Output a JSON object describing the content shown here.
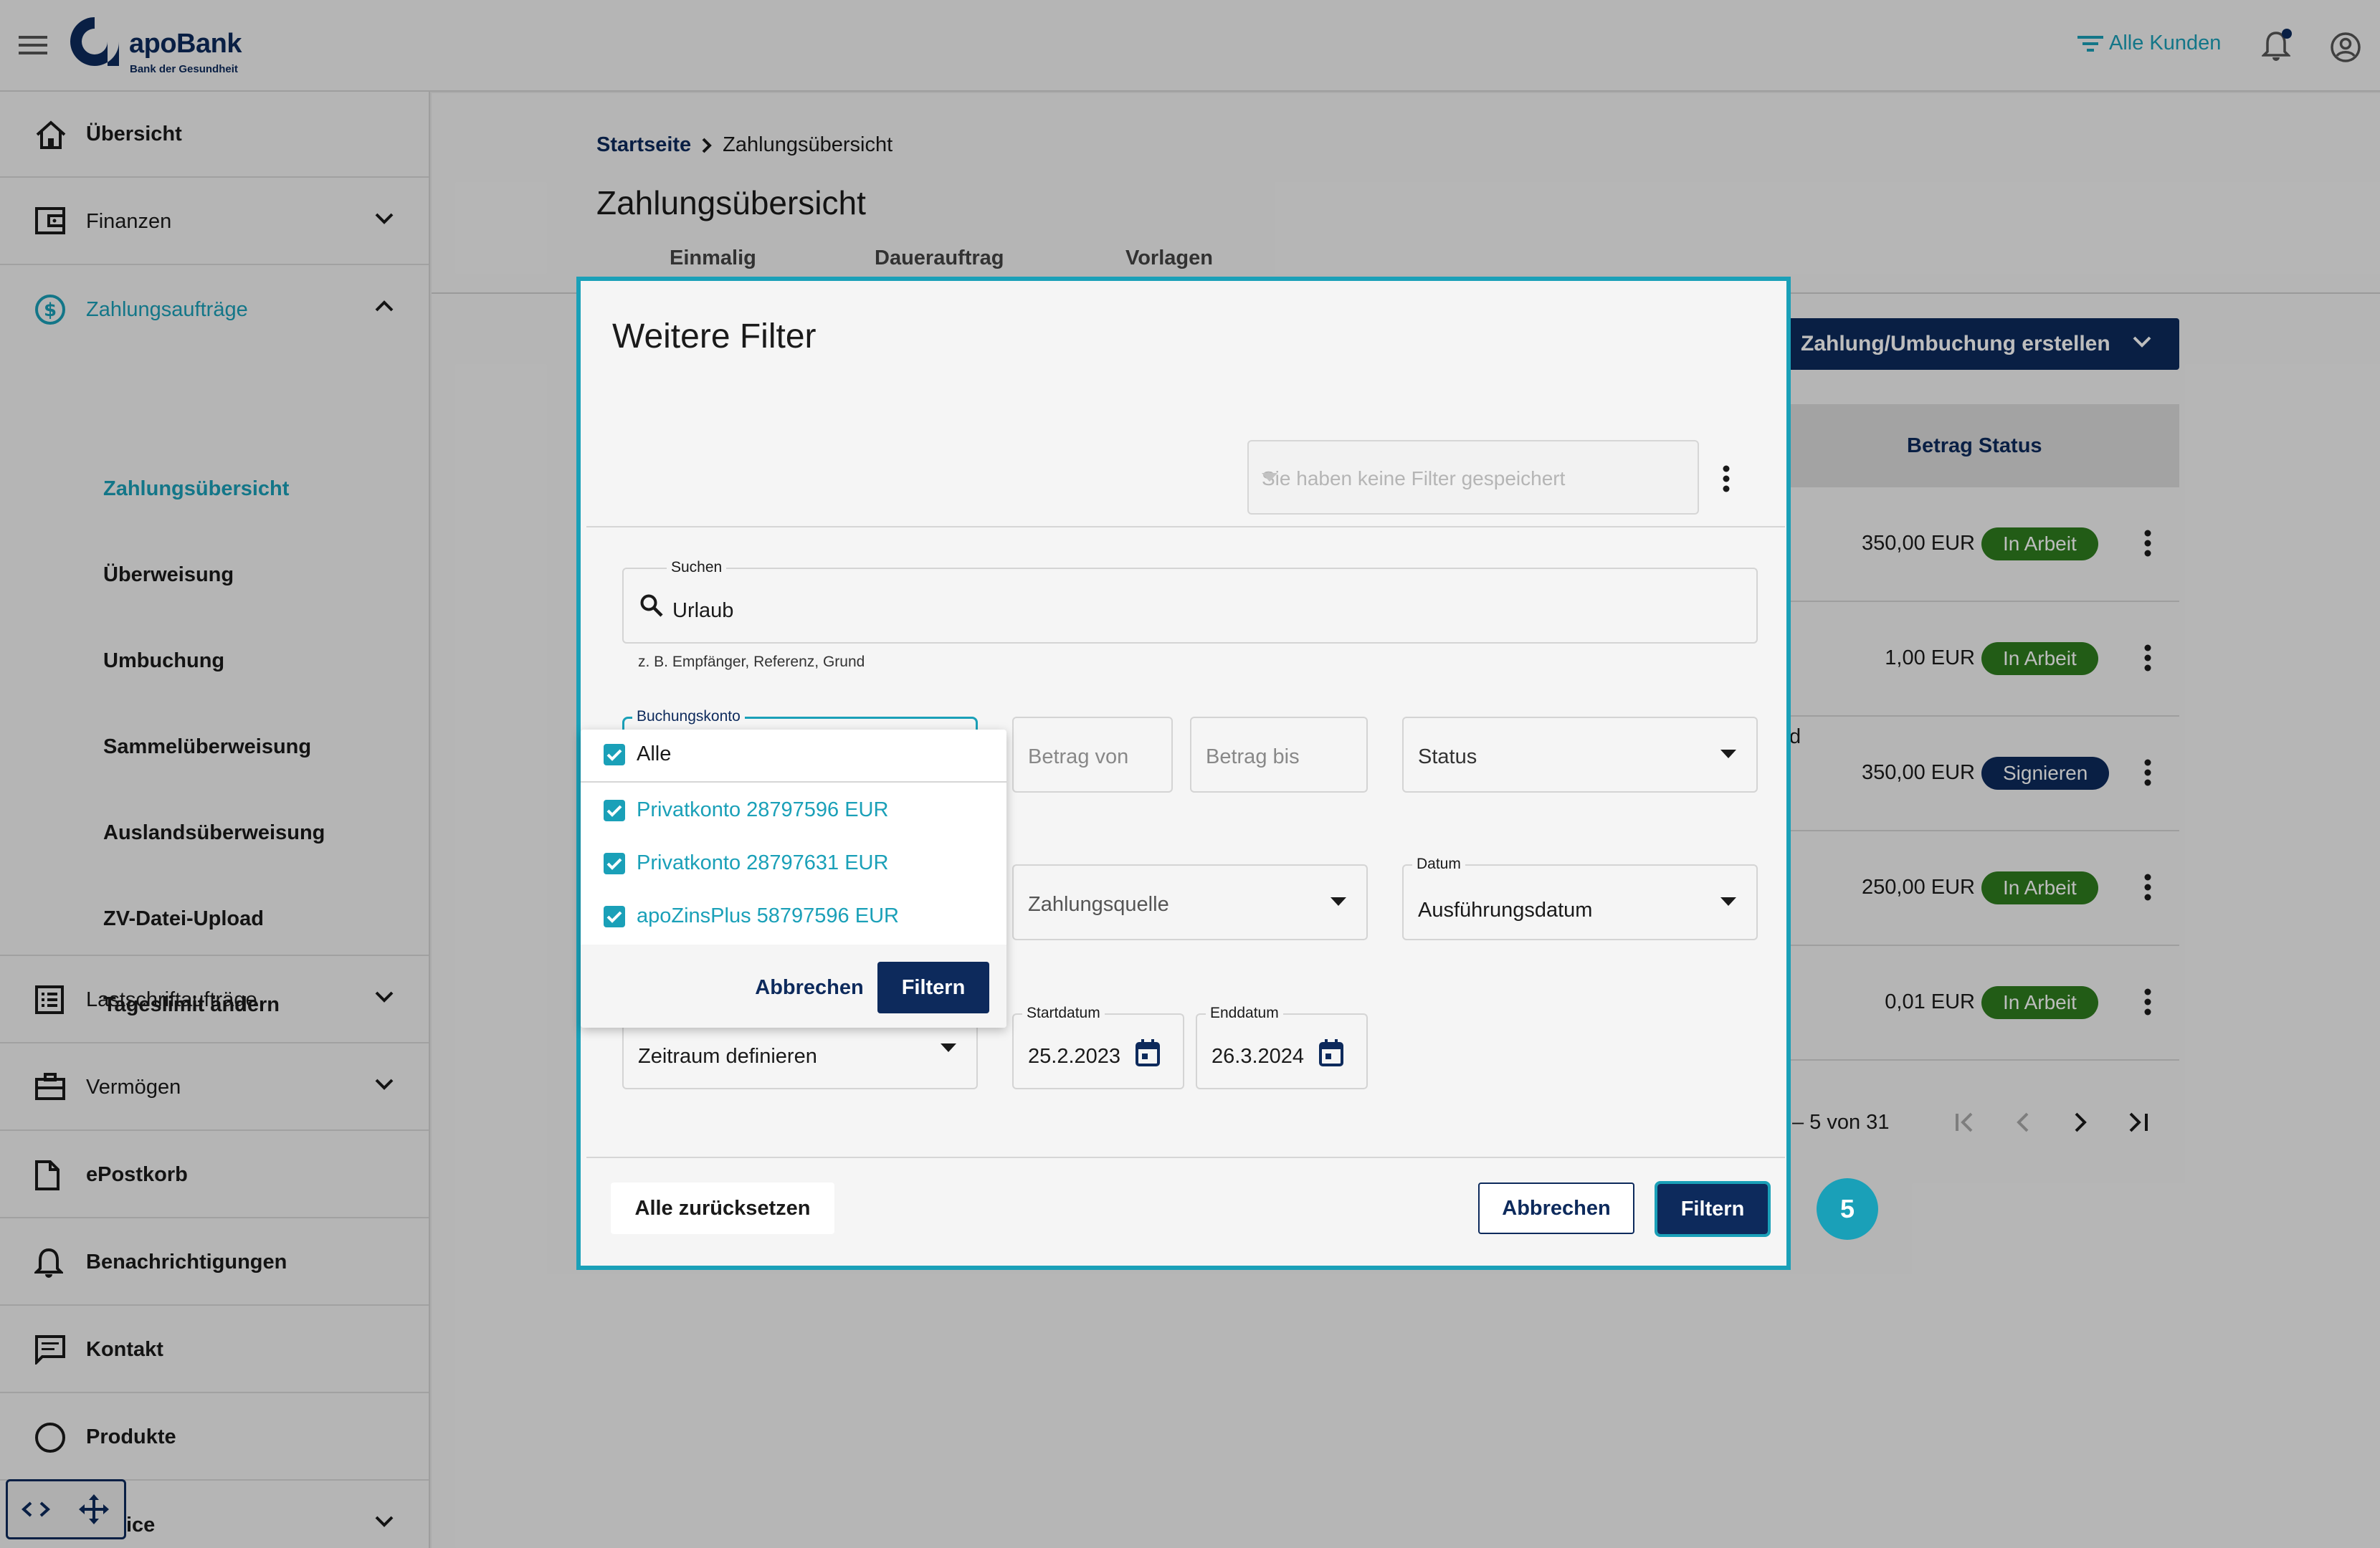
{
  "topbar": {
    "brand_name": "apoBank",
    "brand_tagline": "Bank der Gesundheit",
    "customer_filter_label": "Alle Kunden"
  },
  "sidebar": {
    "items": [
      {
        "label": "Übersicht",
        "icon": "home-icon"
      },
      {
        "label": "Finanzen",
        "icon": "wallet-icon"
      },
      {
        "label": "Zahlungsaufträge",
        "icon": "dollar-circle-icon"
      },
      {
        "label": "Lastschriftaufträge",
        "icon": "list-icon"
      },
      {
        "label": "Vermögen",
        "icon": "briefcase-icon"
      },
      {
        "label": "ePostkorb",
        "icon": "document-icon"
      },
      {
        "label": "Benachrichtigungen",
        "icon": "bell-icon"
      },
      {
        "label": "Kontakt",
        "icon": "chat-icon"
      },
      {
        "label": "Produkte",
        "icon": "circle-icon"
      },
      {
        "label": "ice",
        "icon": "service-icon"
      }
    ],
    "sub_items": [
      "Zahlungsübersicht",
      "Überweisung",
      "Umbuchung",
      "Sammelüberweisung",
      "Auslandsüberweisung",
      "ZV-Datei-Upload",
      "Tageslimit ändern"
    ]
  },
  "page": {
    "breadcrumb_home": "Startseite",
    "breadcrumb_current": "Zahlungsübersicht",
    "title": "Zahlungsübersicht",
    "tabs": [
      "Einmalig",
      "Dauerauftrag",
      "Vorlagen"
    ],
    "create_button": "Zahlung/Umbuchung erstellen",
    "table_header": "Betrag Status",
    "rows": [
      {
        "amount": "350,00 EUR",
        "status": "In Arbeit",
        "color": "#2e7d1e"
      },
      {
        "amount": "1,00 EUR",
        "status": "In Arbeit",
        "color": "#2e7d1e"
      },
      {
        "amount": "350,00 EUR",
        "status": "Signieren",
        "color": "#0d2a5c"
      },
      {
        "amount": "250,00 EUR",
        "status": "In Arbeit",
        "color": "#2e7d1e"
      },
      {
        "amount": "0,01 EUR",
        "status": "In Arbeit",
        "color": "#2e7d1e"
      }
    ],
    "row_stub": "d",
    "pagination_text": "– 5 von 31"
  },
  "dialog": {
    "title": "Weitere Filter",
    "saved_filters_placeholder": "Sie haben keine Filter gespeichert",
    "search_label": "Suchen",
    "search_value": "Urlaub",
    "search_hint": "z. B. Empfänger, Referenz, Grund",
    "account_label": "Buchungskonto",
    "amount_from_placeholder": "Betrag von",
    "amount_to_placeholder": "Betrag bis",
    "status_placeholder": "Status",
    "source_placeholder": "Zahlungsquelle",
    "date_label": "Datum",
    "date_value": "Ausführungsdatum",
    "period_value": "Zeitraum definieren",
    "start_label": "Startdatum",
    "start_value": "25.2.2023",
    "end_label": "Enddatum",
    "end_value": "26.3.2024",
    "reset_button": "Alle zurücksetzen",
    "cancel_button": "Abbrechen",
    "filter_button": "Filtern",
    "step_badge": "5"
  },
  "dropdown": {
    "all_label": "Alle",
    "options": [
      "Privatkonto 28797596 EUR",
      "Privatkonto 28797631 EUR",
      "apoZinsPlus 58797596 EUR"
    ],
    "cancel_button": "Abbrechen",
    "filter_button": "Filtern"
  },
  "colors": {
    "brand_navy": "#0d2a5c",
    "accent_teal": "#1aa0b8",
    "status_green": "#2e7d1e"
  }
}
